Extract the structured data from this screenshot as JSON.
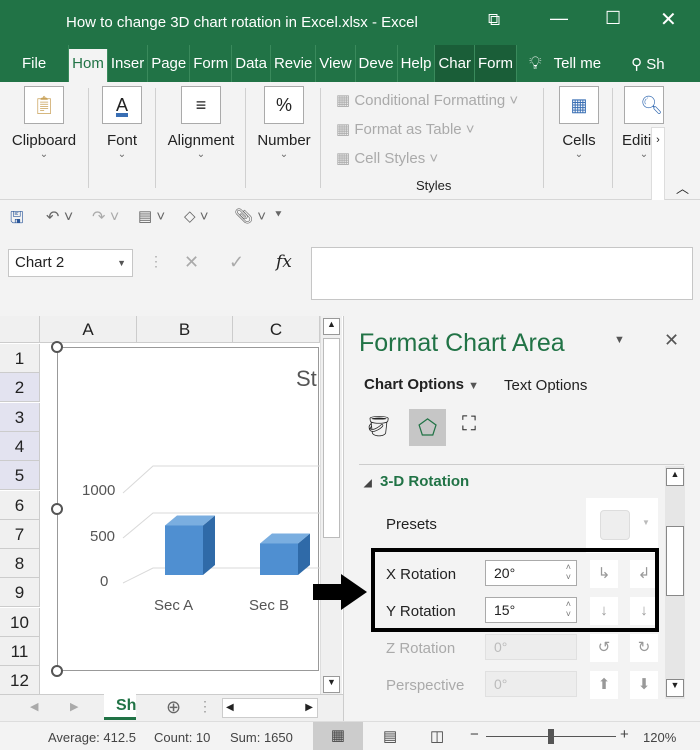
{
  "window": {
    "title": "How to change 3D chart rotation in Excel.xlsx  -  Excel"
  },
  "tabs": [
    "File",
    "Hom",
    "Inser",
    "Page",
    "Form",
    "Data",
    "Revie",
    "View",
    "Deve",
    "Help",
    "Char",
    "Form"
  ],
  "tell_me": "Tell me",
  "share": "Sh",
  "ribbon": {
    "groups": [
      "Clipboard",
      "Font",
      "Alignment",
      "Number",
      "Cells",
      "Editi"
    ],
    "styles": {
      "conditional": "Conditional Formatting",
      "table": "Format as Table",
      "cell": "Cell Styles",
      "label": "Styles"
    }
  },
  "namebox": "Chart 2",
  "fx": "fx",
  "columns": [
    "A",
    "B",
    "C"
  ],
  "rows": [
    "1",
    "2",
    "3",
    "4",
    "5",
    "6",
    "7",
    "8",
    "9",
    "10",
    "11",
    "12"
  ],
  "chart": {
    "title": "St",
    "yticks": [
      "1000",
      "500",
      "0"
    ],
    "categories": [
      "Sec A",
      "Sec B"
    ],
    "values": [
      550,
      350
    ],
    "bar_color": "#4f8fd1"
  },
  "sheet_tab": "Sh",
  "panel": {
    "title": "Format Chart Area",
    "tab_chart": "Chart Options",
    "tab_text": "Text Options",
    "section": "3-D Rotation",
    "presets": "Presets",
    "x_label": "X Rotation",
    "x_value": "20°",
    "y_label": "Y Rotation",
    "y_value": "15°",
    "z_label": "Z Rotation",
    "z_value": "0°",
    "p_label": "Perspective",
    "p_value": "0°"
  },
  "status": {
    "average": "Average: 412.5",
    "count": "Count: 10",
    "sum": "Sum: 1650",
    "zoom": "120%"
  }
}
